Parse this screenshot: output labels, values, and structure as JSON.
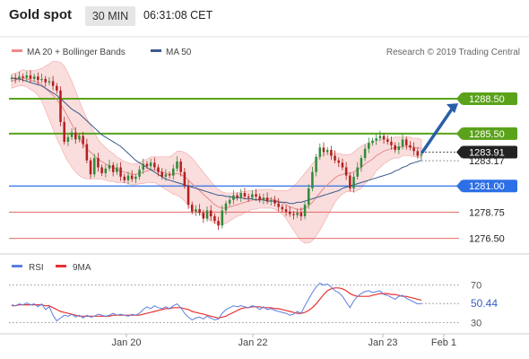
{
  "header": {
    "title": "Gold spot",
    "timeframe": "30 MIN",
    "time": "06:31:08 CET"
  },
  "colors": {
    "up_candle": "#2f8b3a",
    "down_candle": "#b21f1f",
    "bollinger_fill": "#f6c6c6",
    "ma20": "#e88a8a",
    "ma50": "#3a5a8c",
    "resistance": "#5aa21a",
    "current": "#222222",
    "pivot": "#2d6fe6",
    "support": "#e46a6a",
    "arrow": "#2a5fa8",
    "rsi": "#5b7ee0",
    "rsi_ma": "#e83030"
  },
  "chart_data": [
    {
      "type": "candlestick",
      "title": "Gold spot",
      "legend": [
        {
          "label": "MA 20 + Bollinger Bands",
          "color": "#ef8a8a"
        },
        {
          "label": "MA 50",
          "color": "#3a5a8c"
        }
      ],
      "legend_position": "top-left",
      "credit": "Research © 2019 Trading Central",
      "x_ticks": [
        "Jan 20",
        "Jan 22",
        "Jan 23",
        "Feb 1"
      ],
      "ylim": [
        1275.7,
        1290.5
      ],
      "levels": [
        {
          "label": "1288.50",
          "value": 1288.5,
          "kind": "resistance"
        },
        {
          "label": "1285.50",
          "value": 1285.5,
          "kind": "resistance"
        },
        {
          "label": "1283.91",
          "value": 1283.91,
          "kind": "current"
        },
        {
          "label": "1283.17",
          "value": 1283.17,
          "kind": "reference"
        },
        {
          "label": "1281.00",
          "value": 1281.0,
          "kind": "pivot"
        },
        {
          "label": "1278.75",
          "value": 1278.75,
          "kind": "support"
        },
        {
          "label": "1276.50",
          "value": 1276.5,
          "kind": "support"
        }
      ],
      "close_series": [
        1290.3,
        1290.2,
        1290.4,
        1290.3,
        1290.5,
        1290.2,
        1290.4,
        1290.1,
        1290.2,
        1289.9,
        1290.0,
        1289.6,
        1289.2,
        1286.5,
        1284.8,
        1285.2,
        1285.6,
        1285.0,
        1285.3,
        1284.6,
        1283.2,
        1282.0,
        1283.4,
        1282.6,
        1282.1,
        1282.5,
        1282.8,
        1282.2,
        1282.6,
        1281.8,
        1281.5,
        1281.9,
        1281.6,
        1281.8,
        1282.4,
        1282.9,
        1282.7,
        1283.0,
        1282.6,
        1282.2,
        1281.8,
        1282.0,
        1281.9,
        1282.5,
        1283.1,
        1282.2,
        1281.0,
        1279.4,
        1278.8,
        1279.0,
        1278.7,
        1278.2,
        1278.9,
        1278.4,
        1278.0,
        1277.6,
        1278.9,
        1279.5,
        1279.8,
        1280.2,
        1280.0,
        1280.4,
        1280.1,
        1280.0,
        1280.3,
        1280.1,
        1279.8,
        1280.0,
        1279.7,
        1279.8,
        1279.5,
        1279.2,
        1279.0,
        1278.8,
        1278.6,
        1278.5,
        1278.7,
        1278.4,
        1279.4,
        1280.8,
        1282.2,
        1283.5,
        1284.3,
        1283.9,
        1284.1,
        1283.6,
        1283.2,
        1283.0,
        1282.6,
        1281.9,
        1280.8,
        1281.8,
        1282.6,
        1283.4,
        1284.2,
        1284.7,
        1284.9,
        1285.1,
        1285.3,
        1285.0,
        1284.8,
        1284.5,
        1284.1,
        1284.4,
        1285.0,
        1284.5,
        1284.3,
        1284.0,
        1283.6,
        1283.7
      ],
      "ma20_series": [
        1290.0,
        1290.1,
        1290.2,
        1290.3,
        1290.2,
        1290.1,
        1290.0,
        1289.9,
        1289.7,
        1289.4,
        1289.1,
        1288.8,
        1288.4,
        1288.0,
        1287.5,
        1286.9,
        1286.3,
        1285.7,
        1285.1,
        1284.6,
        1284.2,
        1283.9,
        1283.6,
        1283.3,
        1283.1,
        1282.9,
        1282.7,
        1282.6,
        1282.4,
        1282.3,
        1282.2,
        1282.1,
        1282.0,
        1282.0,
        1282.1,
        1282.2,
        1282.3,
        1282.4,
        1282.4,
        1282.3,
        1282.2,
        1282.1,
        1282.0,
        1282.0,
        1282.1,
        1282.0,
        1281.8,
        1281.5,
        1281.2,
        1280.9,
        1280.6,
        1280.3,
        1280.0,
        1279.7,
        1279.4,
        1279.2,
        1279.1,
        1279.1,
        1279.2,
        1279.3,
        1279.4,
        1279.5,
        1279.6,
        1279.7,
        1279.8,
        1279.8,
        1279.9,
        1279.9,
        1279.9,
        1279.9,
        1279.8,
        1279.7,
        1279.6,
        1279.4,
        1279.2,
        1279.1,
        1279.0,
        1279.0,
        1279.1,
        1279.3,
        1279.6,
        1280.0,
        1280.4,
        1280.8,
        1281.1,
        1281.4,
        1281.7,
        1281.9,
        1282.0,
        1282.1,
        1282.1,
        1282.2,
        1282.4,
        1282.6,
        1282.9,
        1283.1,
        1283.3,
        1283.6,
        1283.8,
        1284.0,
        1284.1,
        1284.2,
        1284.3,
        1284.3,
        1284.4,
        1284.4,
        1284.4,
        1284.3,
        1284.3,
        1284.2
      ],
      "bb_width_series": [
        0.6,
        0.6,
        0.6,
        0.7,
        0.7,
        0.8,
        0.9,
        1.1,
        1.4,
        1.9,
        2.4,
        2.9,
        3.3,
        3.6,
        3.8,
        3.8,
        3.7,
        3.5,
        3.2,
        2.9,
        2.6,
        2.3,
        2.0,
        1.7,
        1.5,
        1.4,
        1.3,
        1.2,
        1.1,
        1.0,
        0.9,
        0.9,
        0.9,
        0.9,
        0.9,
        1.0,
        1.0,
        1.1,
        1.1,
        1.2,
        1.3,
        1.4,
        1.5,
        1.7,
        1.9,
        2.0,
        2.1,
        2.2,
        2.2,
        2.1,
        2.0,
        1.9,
        1.8,
        1.7,
        1.6,
        1.5,
        1.4,
        1.3,
        1.2,
        1.1,
        1.0,
        1.0,
        0.9,
        0.9,
        0.8,
        0.8,
        0.8,
        0.8,
        0.8,
        0.8,
        0.8,
        0.9,
        1.0,
        1.2,
        1.5,
        1.9,
        2.3,
        2.7,
        3.0,
        3.2,
        3.3,
        3.3,
        3.2,
        3.0,
        2.7,
        2.4,
        2.1,
        1.9,
        1.7,
        1.6,
        1.6,
        1.7,
        1.8,
        1.8,
        1.7,
        1.6,
        1.5,
        1.3,
        1.2,
        1.1,
        1.0,
        0.9,
        0.9,
        0.9,
        0.8,
        0.8,
        0.8,
        0.8,
        0.8,
        0.8
      ],
      "ma50_series": [
        1290.3,
        1290.2,
        1290.2,
        1290.1,
        1290.0,
        1289.9,
        1289.8,
        1289.7,
        1289.6,
        1289.4,
        1289.2,
        1289.0,
        1288.8,
        1288.5,
        1288.2,
        1287.9,
        1287.6,
        1287.4,
        1287.2,
        1286.9,
        1286.6,
        1286.3,
        1286.0,
        1285.7,
        1285.4,
        1285.2,
        1285.0,
        1284.8,
        1284.6,
        1284.4,
        1284.1,
        1283.8,
        1283.5,
        1283.2,
        1283.0,
        1282.8,
        1282.6,
        1282.4,
        1282.2,
        1282.0,
        1281.8,
        1281.6,
        1281.5,
        1281.4,
        1281.3,
        1281.2,
        1281.1,
        1281.0,
        1280.9,
        1280.8,
        1280.7,
        1280.6,
        1280.5,
        1280.4,
        1280.3,
        1280.2,
        1280.2,
        1280.1,
        1280.1,
        1280.0,
        1280.0,
        1280.0,
        1279.9,
        1279.9,
        1279.9,
        1279.8,
        1279.8,
        1279.8,
        1279.7,
        1279.7,
        1279.7,
        1279.6,
        1279.6,
        1279.6,
        1279.5,
        1279.5,
        1279.6,
        1279.6,
        1279.7,
        1279.8,
        1279.9,
        1280.0,
        1280.1,
        1280.2,
        1280.3,
        1280.4,
        1280.5,
        1280.6,
        1280.8,
        1280.9,
        1281.0,
        1281.1,
        1281.2,
        1281.3,
        1281.4,
        1281.5,
        1281.6,
        1281.7,
        1281.8,
        1281.9,
        1282.0,
        1282.1,
        1282.3,
        1282.4,
        1282.6,
        1282.7,
        1282.9,
        1283.0,
        1283.1,
        1283.2
      ],
      "forecast_arrow": {
        "from": 1283.9,
        "to": 1288.1
      }
    },
    {
      "type": "line",
      "title": "RSI",
      "legend": [
        {
          "label": "RSI",
          "color": "#5b7ee0"
        },
        {
          "label": "9MA",
          "color": "#e83030"
        }
      ],
      "legend_position": "top-left",
      "ylim": [
        22,
        82
      ],
      "y_ticks": [
        70,
        30
      ],
      "current_value_label": "50.44",
      "series": [
        {
          "name": "RSI",
          "values": [
            49,
            48,
            50,
            49,
            51,
            49,
            50,
            47,
            50,
            44,
            47,
            38,
            32,
            35,
            38,
            37,
            39,
            36,
            38,
            35,
            38,
            36,
            37,
            39,
            38,
            37,
            38,
            40,
            38,
            39,
            38,
            37,
            39,
            38,
            40,
            44,
            47,
            45,
            48,
            46,
            45,
            47,
            45,
            48,
            50,
            46,
            40,
            36,
            33,
            35,
            36,
            34,
            37,
            35,
            33,
            34,
            40,
            44,
            46,
            48,
            47,
            48,
            47,
            46,
            48,
            47,
            44,
            47,
            44,
            45,
            43,
            42,
            41,
            40,
            38,
            39,
            42,
            40,
            48,
            55,
            62,
            68,
            72,
            70,
            71,
            68,
            64,
            62,
            58,
            52,
            46,
            53,
            58,
            61,
            63,
            64,
            62,
            63,
            64,
            60,
            59,
            57,
            55,
            58,
            59,
            56,
            54,
            52,
            50,
            50.4
          ]
        },
        {
          "name": "9MA",
          "values": [
            48,
            48,
            49,
            49,
            49,
            49,
            49,
            49,
            49,
            48,
            48,
            46,
            44,
            42,
            41,
            40,
            39,
            38,
            37,
            37,
            37,
            37,
            37,
            37,
            37,
            37,
            37,
            38,
            38,
            38,
            38,
            38,
            38,
            38,
            38,
            39,
            40,
            41,
            42,
            43,
            44,
            45,
            45,
            46,
            46,
            46,
            45,
            44,
            42,
            41,
            40,
            39,
            38,
            37,
            36,
            35,
            36,
            37,
            39,
            41,
            43,
            45,
            46,
            46,
            47,
            47,
            47,
            46,
            46,
            46,
            45,
            45,
            44,
            43,
            42,
            41,
            40,
            40,
            41,
            43,
            46,
            50,
            55,
            60,
            64,
            66,
            67,
            67,
            66,
            64,
            61,
            59,
            58,
            58,
            58,
            58,
            59,
            60,
            61,
            61,
            61,
            60,
            60,
            59,
            58,
            58,
            57,
            56,
            55,
            54
          ]
        }
      ],
      "x_ticks": [
        "Jan 20",
        "Jan 22",
        "Jan 23",
        "Feb 1"
      ]
    }
  ]
}
